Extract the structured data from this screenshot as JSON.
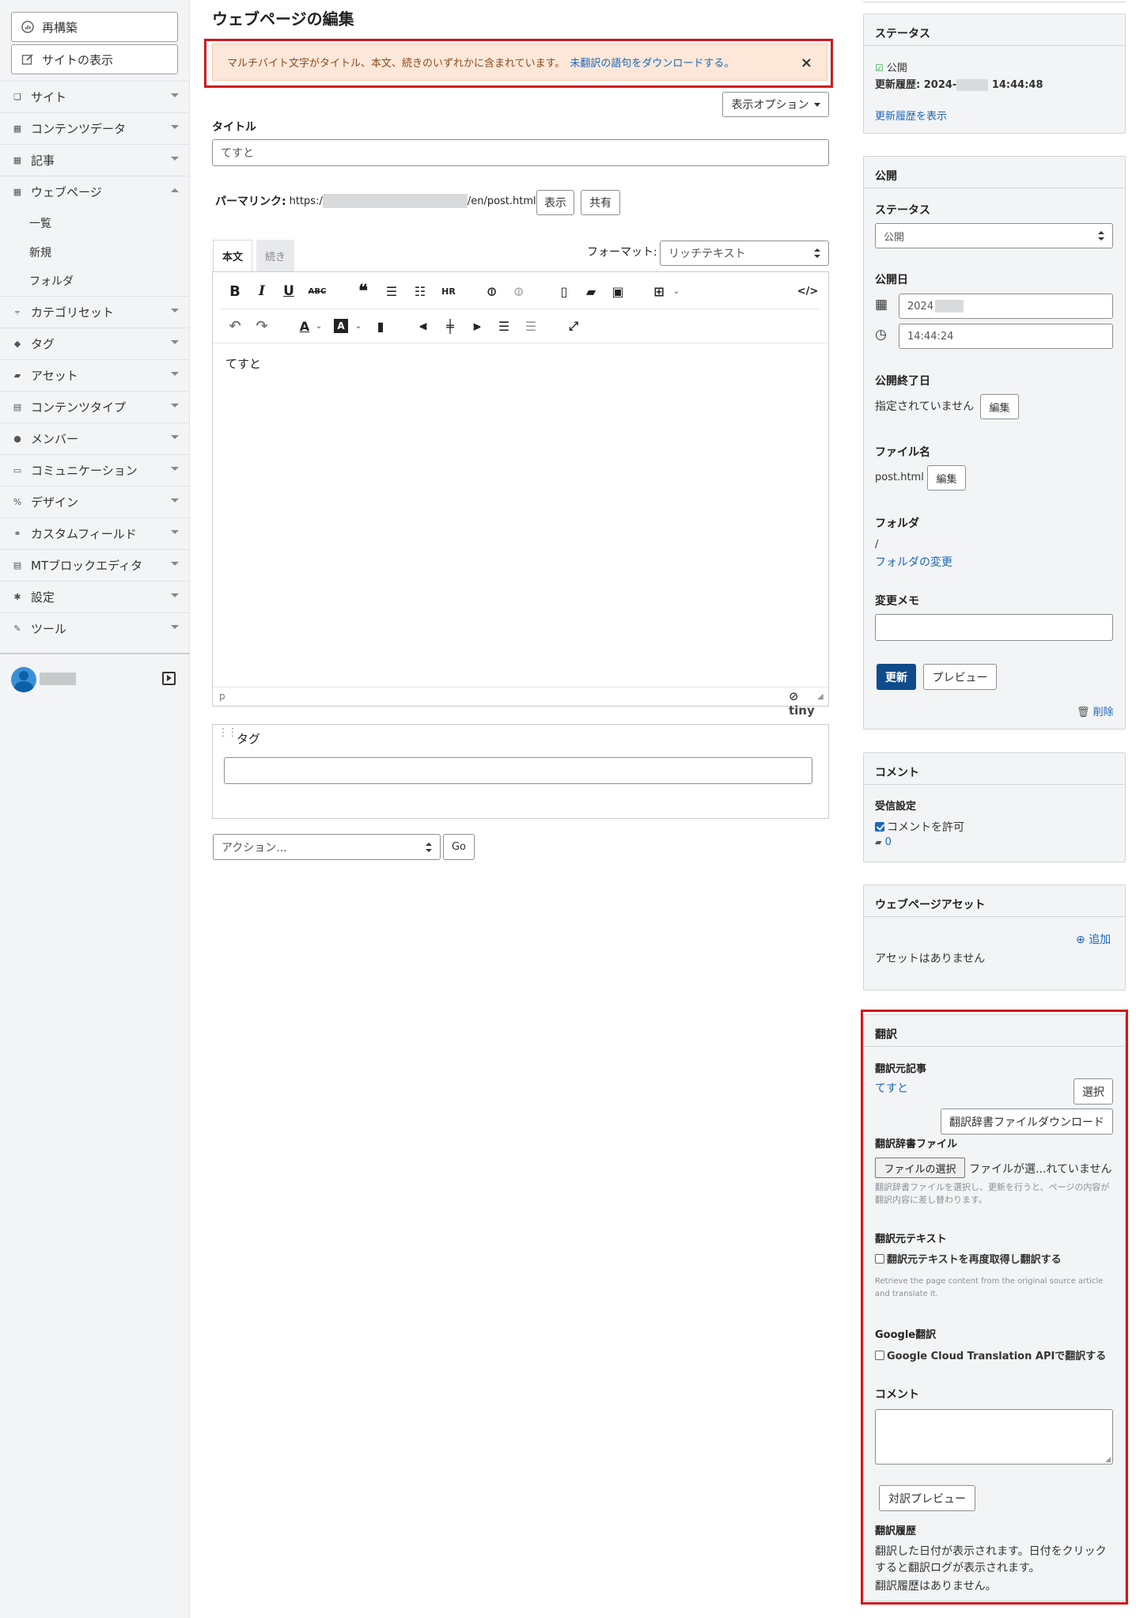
{
  "sidebar": {
    "rebuild_label": "再構築",
    "view_site_label": "サイトの表示",
    "nav": [
      {
        "label": "サイト",
        "icon": "site-icon"
      },
      {
        "label": "コンテンツデータ",
        "icon": "content-data-icon"
      },
      {
        "label": "記事",
        "icon": "entry-icon"
      },
      {
        "label": "ウェブページ",
        "icon": "webpage-icon"
      },
      {
        "label": "カテゴリセット",
        "icon": "category-set-icon"
      },
      {
        "label": "タグ",
        "icon": "tag-icon"
      },
      {
        "label": "アセット",
        "icon": "asset-icon"
      },
      {
        "label": "コンテンツタイプ",
        "icon": "content-type-icon"
      },
      {
        "label": "メンバー",
        "icon": "member-icon"
      },
      {
        "label": "コミュニケーション",
        "icon": "communication-icon"
      },
      {
        "label": "デザイン",
        "icon": "design-icon"
      },
      {
        "label": "カスタムフィールド",
        "icon": "custom-field-icon"
      },
      {
        "label": "MTブロックエディタ",
        "icon": "block-editor-icon"
      },
      {
        "label": "設定",
        "icon": "gear-icon"
      },
      {
        "label": "ツール",
        "icon": "wrench-icon"
      }
    ],
    "webpage_sub": [
      "一覧",
      "新規",
      "フォルダ"
    ]
  },
  "main": {
    "title": "ウェブページの編集",
    "alert_text": "マルチバイト文字がタイトル、本文、続きのいずれかに含まれています。",
    "alert_link": "未翻訳の語句をダウンロードする。",
    "alert_close": "×",
    "display_options": "表示オプション",
    "title_label": "タイトル",
    "title_value": "てすと",
    "permalink_label": "パーマリンク:",
    "permalink_prefix": "https:/",
    "permalink_suffix": "/en/post.html",
    "view_btn": "表示",
    "share_btn": "共有",
    "tab_body": "本文",
    "tab_more": "続き",
    "format_label": "フォーマット:",
    "format_value": "リッチテキスト",
    "editor_text": "てすと",
    "status_path": "p",
    "tiny_logo": "tiny",
    "tag_label": "タグ",
    "action_select": "アクション...",
    "go_btn": "Go"
  },
  "panels": {
    "status": {
      "title": "ステータス",
      "state": "公開",
      "history_prefix": "更新履歴: 2024-",
      "history_time": "14:44:48",
      "history_link": "更新履歴を表示"
    },
    "publish": {
      "title": "公開",
      "status_label": "ステータス",
      "status_value": "公開",
      "date_label": "公開日",
      "date_value": "2024",
      "time_value": "14:44:24",
      "end_label": "公開終了日",
      "end_value": "指定されていません",
      "edit_btn": "編集",
      "filename_label": "ファイル名",
      "filename_value": "post.html",
      "folder_label": "フォルダ",
      "folder_value": "/",
      "folder_link": "フォルダの変更",
      "memo_label": "変更メモ",
      "update_btn": "更新",
      "preview_btn": "プレビュー",
      "delete_link": "削除"
    },
    "comment": {
      "title": "コメント",
      "recv_label": "受信設定",
      "allow_label": "コメントを許可",
      "count": "0"
    },
    "asset": {
      "title": "ウェブページアセット",
      "add_link": "追加",
      "empty_text": "アセットはありません"
    },
    "translation": {
      "title": "翻訳",
      "source_label": "翻訳元記事",
      "source_value": "てすと",
      "select_btn": "選択",
      "dict_download_btn": "翻訳辞書ファイルダウンロード",
      "dict_label": "翻訳辞書ファイル",
      "file_btn": "ファイルの選択",
      "file_status": "ファイルが選...れていません",
      "dict_help": "翻訳辞書ファイルを選択し、更新を行うと、ページの内容が翻訳内容に差し替わります。",
      "src_text_label": "翻訳元テキスト",
      "src_text_check": "翻訳元テキストを再度取得し翻訳する",
      "src_text_help": "Retrieve the page content from the original source article and translate it.",
      "google_label": "Google翻訳",
      "google_check": "Google Cloud Translation APIで翻訳する",
      "comment_label": "コメント",
      "preview_btn": "対訳プレビュー",
      "history_label": "翻訳履歴",
      "history_help": "翻訳した日付が表示されます。日付をクリックすると翻訳ログが表示されます。",
      "history_empty": "翻訳履歴はありません。"
    }
  },
  "colors": {
    "accent": "#1c67b8",
    "primary_btn": "#0f4a8a",
    "alert_bg": "#fde7d9",
    "highlight": "#d0191e"
  }
}
